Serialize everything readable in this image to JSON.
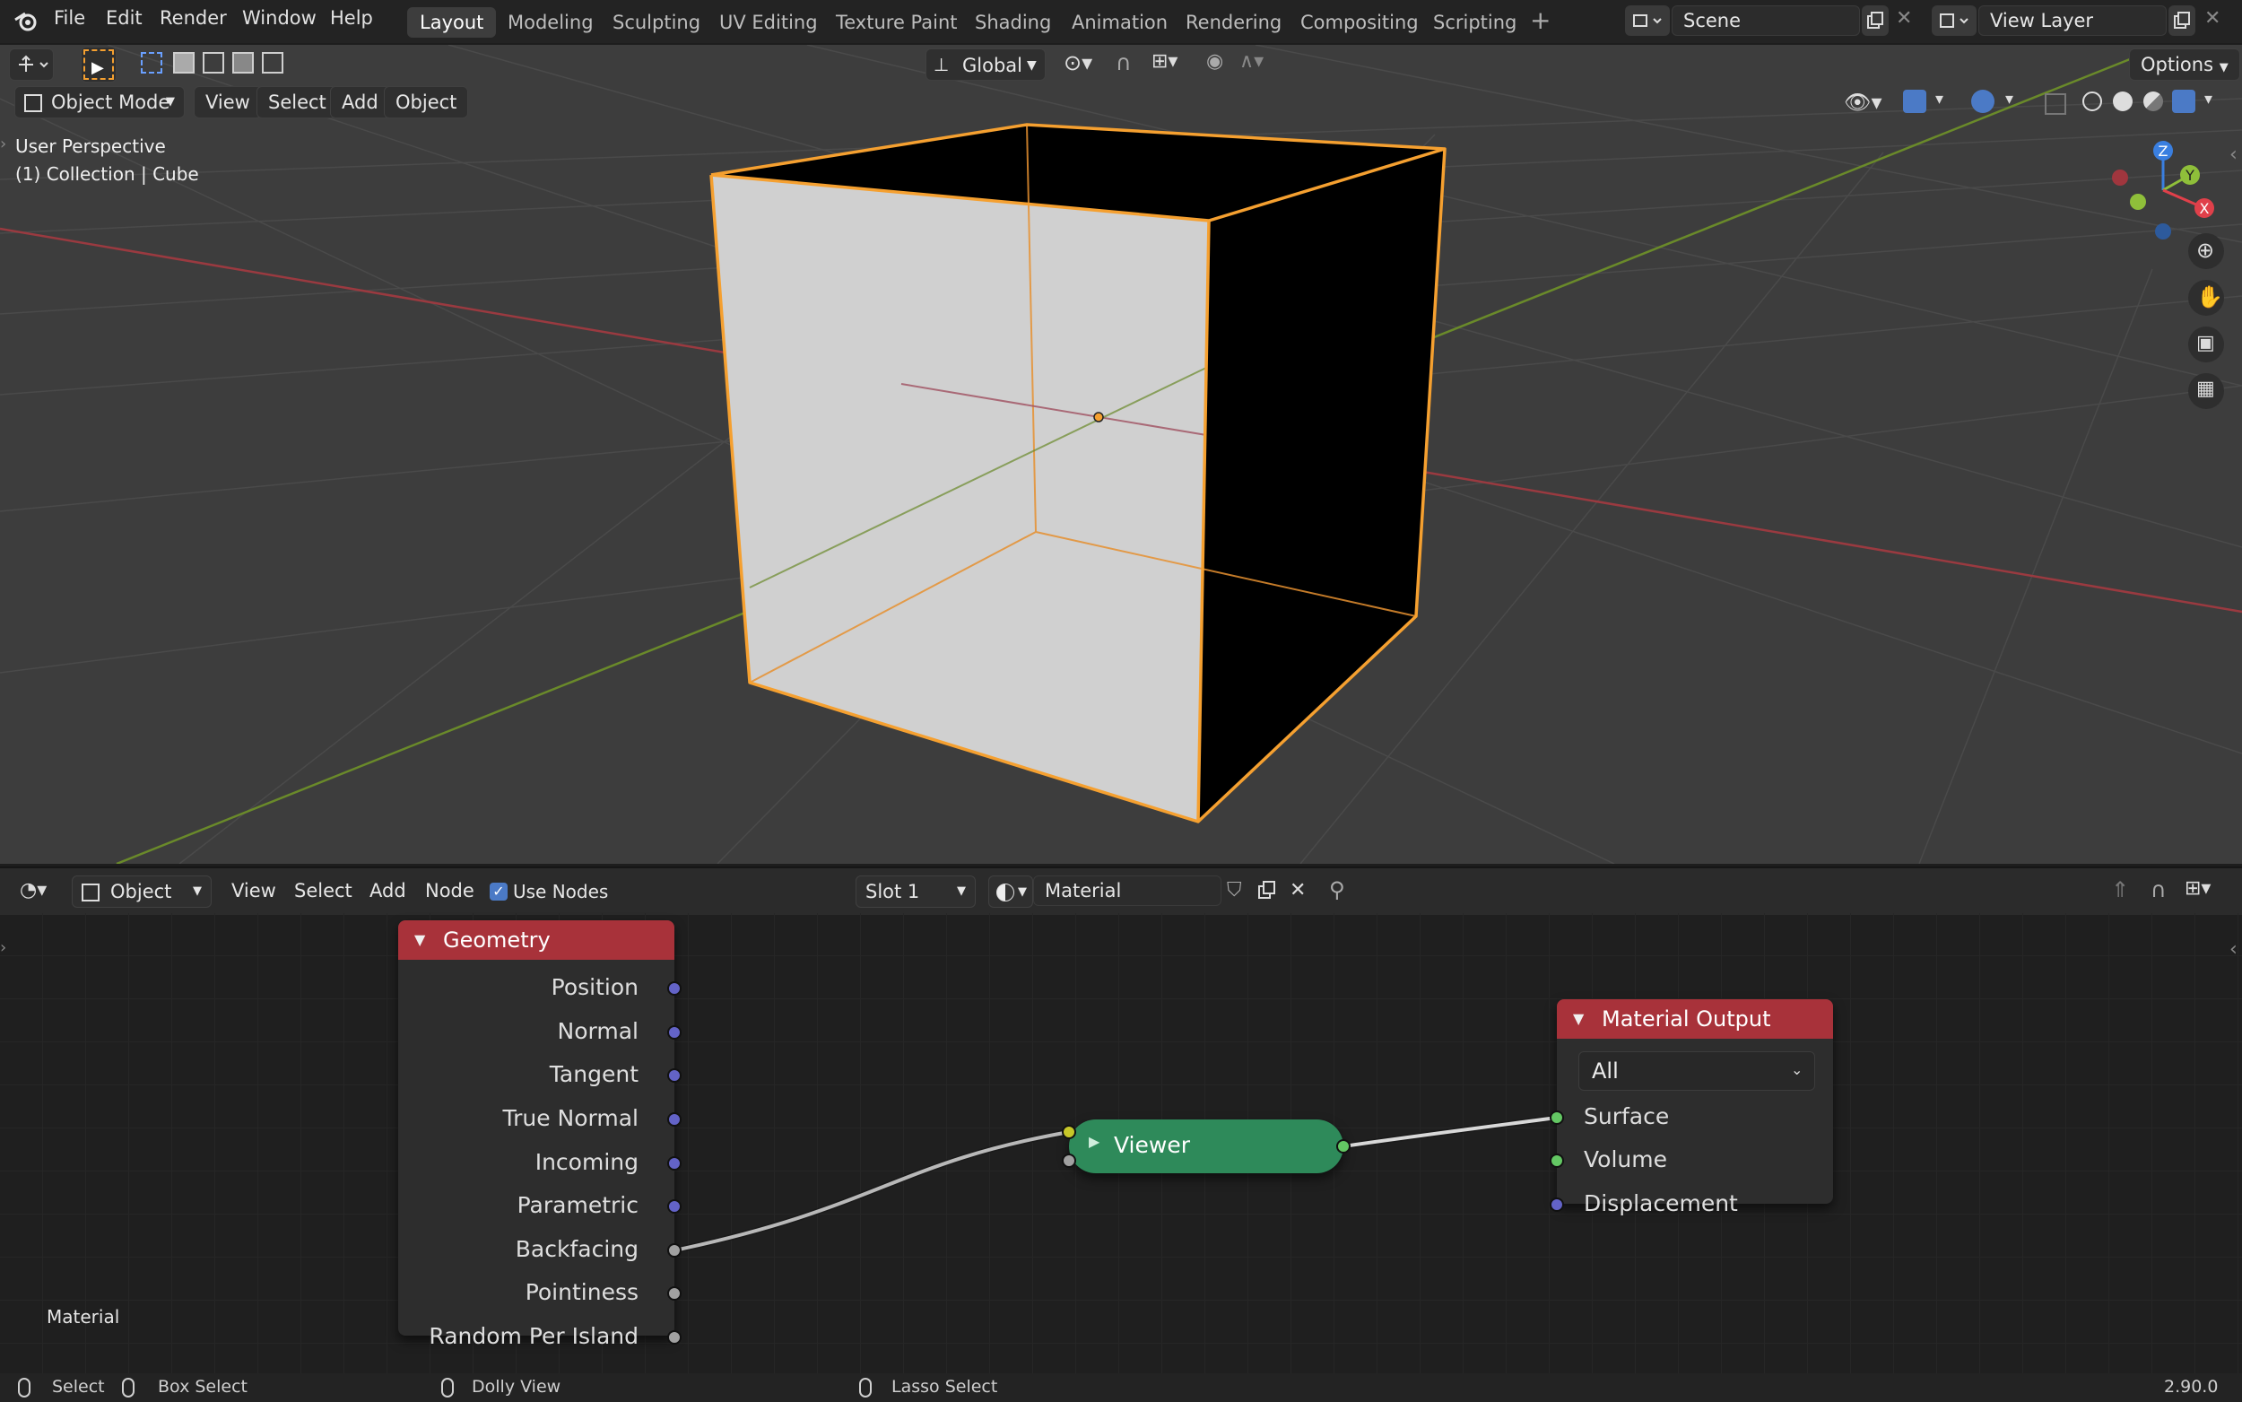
{
  "topbar": {
    "menus": [
      "File",
      "Edit",
      "Render",
      "Window",
      "Help"
    ],
    "workspaces": [
      "Layout",
      "Modeling",
      "Sculpting",
      "UV Editing",
      "Texture Paint",
      "Shading",
      "Animation",
      "Rendering",
      "Compositing",
      "Scripting"
    ],
    "active_workspace": "Layout",
    "scene_name": "Scene",
    "view_layer_name": "View Layer"
  },
  "tool_header": {
    "orientation": "Global",
    "options_label": "Options"
  },
  "viewport_header": {
    "mode": "Object Mode",
    "menus": [
      "View",
      "Select",
      "Add",
      "Object"
    ]
  },
  "viewport": {
    "perspective_label": "User Perspective",
    "collection_label": "(1) Collection | Cube",
    "gizmo_axes": [
      "Z",
      "Y",
      "X"
    ]
  },
  "node_header": {
    "object_type": "Object",
    "menus": [
      "View",
      "Select",
      "Add",
      "Node"
    ],
    "use_nodes_label": "Use Nodes",
    "use_nodes_checked": true,
    "slot": "Slot 1",
    "material_name": "Material"
  },
  "node_editor": {
    "tree_label": "Material",
    "geometry_node": {
      "title": "Geometry",
      "outputs": [
        "Position",
        "Normal",
        "Tangent",
        "True Normal",
        "Incoming",
        "Parametric",
        "Backfacing",
        "Pointiness",
        "Random Per Island"
      ]
    },
    "viewer_node": {
      "title": "Viewer"
    },
    "output_node": {
      "title": "Material Output",
      "target": "All",
      "inputs": [
        "Surface",
        "Volume",
        "Displacement"
      ]
    }
  },
  "statusbar": {
    "select": "Select",
    "box_select": "Box Select",
    "dolly_view": "Dolly View",
    "lasso_select": "Lasso Select",
    "version": "2.90.0"
  },
  "colors": {
    "selection_outline": "#f5a030",
    "node_header_red": "#a8323a",
    "viewer_green": "#2e8a5a",
    "socket_vector": "#6363c7",
    "socket_shader": "#63c763",
    "socket_float": "#a1a1a1",
    "socket_color": "#c7c729"
  }
}
